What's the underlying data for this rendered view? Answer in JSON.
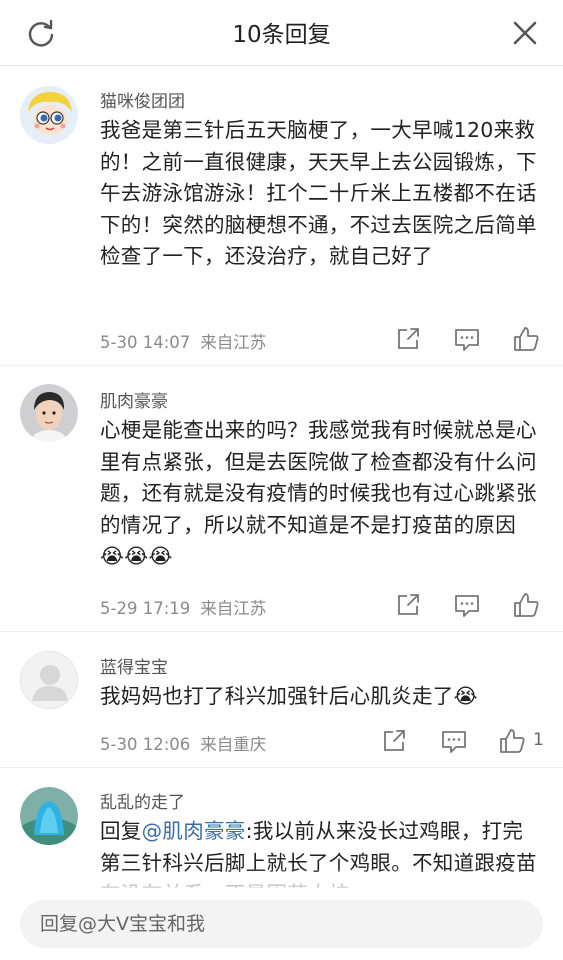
{
  "header": {
    "title": "10条回复",
    "refresh_icon": "refresh-icon",
    "close_icon": "close-icon"
  },
  "comments": [
    {
      "username": "猫咪俊团团",
      "text": "我爸是第三针后五天脑梗了，一大早喊120来救的！之前一直很健康，天天早上去公园锻炼，下午去游泳馆游泳！扛个二十斤米上五楼都不在话下的！突然的脑梗想不通，不过去医院之后简单检查了一下，还没治疗，就自己好了",
      "time": "5-30 14:07",
      "location": "来自江苏"
    },
    {
      "username": "肌肉豪豪",
      "text": "心梗是能查出来的吗？我感觉我有时候就总是心里有点紧张，但是去医院做了检查都没有什么问题，还有就是没有疫情的时候我也有过心跳紧张的情况了，所以就不知道是不是打疫苗的原因😭😭😭",
      "time": "5-29 17:19",
      "location": "来自江苏"
    },
    {
      "username": "蓝得宝宝",
      "text": "我妈妈也打了科兴加强针后心肌炎走了😭",
      "time": "5-30 12:06",
      "location": "来自重庆",
      "likes": "1"
    },
    {
      "username": "乱乱的走了",
      "reply_prefix": "回复",
      "mention": "@肌肉豪豪",
      "text": ":我以前从来没长过鸡眼，打完第三针科兴后脚上就长了个鸡眼。不知道跟疫苗有没有关系，不是因若大校"
    }
  ],
  "reply_bar": {
    "placeholder": "回复@大V宝宝和我"
  },
  "colors": {
    "mention": "#3b6ea7",
    "meta": "#8a8a8a",
    "input_bg": "#f3f3f3"
  },
  "icons": [
    "share-icon",
    "comment-icon",
    "like-icon"
  ]
}
